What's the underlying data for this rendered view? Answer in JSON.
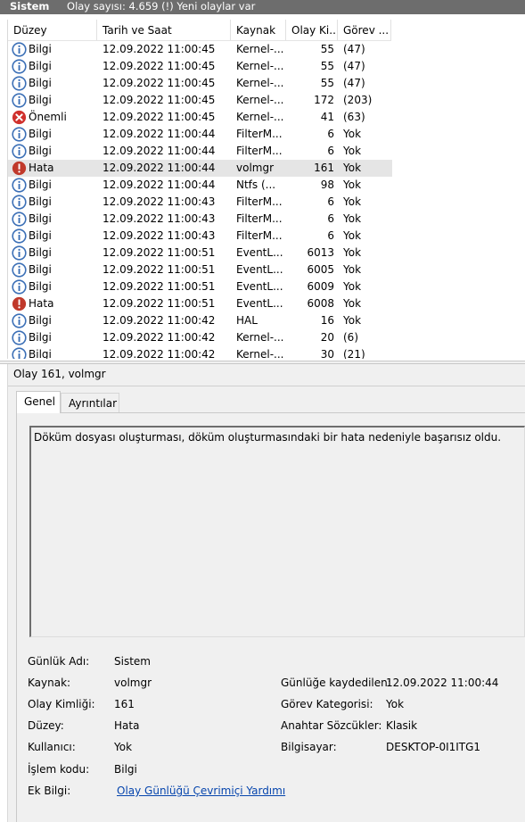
{
  "titlebar": {
    "title": "Sistem",
    "status": "Olay sayısı: 4.659 (!) Yeni olaylar var"
  },
  "columns": {
    "level": "Düzey",
    "date": "Tarih ve Saat",
    "source": "Kaynak",
    "event_id": "Olay Ki...",
    "task": "Görev ..."
  },
  "rows": [
    {
      "type": "info",
      "level": "Bilgi",
      "date": "12.09.2022 11:00:45",
      "source": "Kernel-...",
      "id": "55",
      "task": "(47)"
    },
    {
      "type": "info",
      "level": "Bilgi",
      "date": "12.09.2022 11:00:45",
      "source": "Kernel-...",
      "id": "55",
      "task": "(47)"
    },
    {
      "type": "info",
      "level": "Bilgi",
      "date": "12.09.2022 11:00:45",
      "source": "Kernel-...",
      "id": "55",
      "task": "(47)"
    },
    {
      "type": "info",
      "level": "Bilgi",
      "date": "12.09.2022 11:00:45",
      "source": "Kernel-...",
      "id": "172",
      "task": "(203)"
    },
    {
      "type": "critical",
      "level": "Önemli",
      "date": "12.09.2022 11:00:45",
      "source": "Kernel-...",
      "id": "41",
      "task": "(63)"
    },
    {
      "type": "info",
      "level": "Bilgi",
      "date": "12.09.2022 11:00:44",
      "source": "FilterM...",
      "id": "6",
      "task": "Yok"
    },
    {
      "type": "info",
      "level": "Bilgi",
      "date": "12.09.2022 11:00:44",
      "source": "FilterM...",
      "id": "6",
      "task": "Yok"
    },
    {
      "type": "error",
      "level": "Hata",
      "date": "12.09.2022 11:00:44",
      "source": "volmgr",
      "id": "161",
      "task": "Yok",
      "selected": true
    },
    {
      "type": "info",
      "level": "Bilgi",
      "date": "12.09.2022 11:00:44",
      "source": "Ntfs (...",
      "id": "98",
      "task": "Yok"
    },
    {
      "type": "info",
      "level": "Bilgi",
      "date": "12.09.2022 11:00:43",
      "source": "FilterM...",
      "id": "6",
      "task": "Yok"
    },
    {
      "type": "info",
      "level": "Bilgi",
      "date": "12.09.2022 11:00:43",
      "source": "FilterM...",
      "id": "6",
      "task": "Yok"
    },
    {
      "type": "info",
      "level": "Bilgi",
      "date": "12.09.2022 11:00:43",
      "source": "FilterM...",
      "id": "6",
      "task": "Yok"
    },
    {
      "type": "info",
      "level": "Bilgi",
      "date": "12.09.2022 11:00:51",
      "source": "EventL...",
      "id": "6013",
      "task": "Yok"
    },
    {
      "type": "info",
      "level": "Bilgi",
      "date": "12.09.2022 11:00:51",
      "source": "EventL...",
      "id": "6005",
      "task": "Yok"
    },
    {
      "type": "info",
      "level": "Bilgi",
      "date": "12.09.2022 11:00:51",
      "source": "EventL...",
      "id": "6009",
      "task": "Yok"
    },
    {
      "type": "error",
      "level": "Hata",
      "date": "12.09.2022 11:00:51",
      "source": "EventL...",
      "id": "6008",
      "task": "Yok"
    },
    {
      "type": "info",
      "level": "Bilgi",
      "date": "12.09.2022 11:00:42",
      "source": "HAL",
      "id": "16",
      "task": "Yok"
    },
    {
      "type": "info",
      "level": "Bilgi",
      "date": "12.09.2022 11:00:42",
      "source": "Kernel-...",
      "id": "20",
      "task": "(6)"
    },
    {
      "type": "info",
      "level": "Bilgi",
      "date": "12.09.2022 11:00:42",
      "source": "Kernel-...",
      "id": "30",
      "task": "(21)"
    }
  ],
  "detail": {
    "title": "Olay 161, volmgr",
    "tab_general": "Genel",
    "tab_details": "Ayrıntılar",
    "description": "Döküm dosyası oluşturması, döküm oluşturmasındaki bir hata nedeniyle başarısız oldu.",
    "fields": {
      "log_name_label": "Günlük Adı:",
      "log_name": "Sistem",
      "source_label": "Kaynak:",
      "source": "volmgr",
      "logged_label": "Günlüğe kaydedilen:",
      "logged": "12.09.2022 11:00:44",
      "event_id_label": "Olay Kimliği:",
      "event_id": "161",
      "task_category_label": "Görev Kategorisi:",
      "task_category": "Yok",
      "level_label": "Düzey:",
      "level": "Hata",
      "keywords_label": "Anahtar Sözcükler:",
      "keywords": "Klasik",
      "user_label": "Kullanıcı:",
      "user": "Yok",
      "computer_label": "Bilgisayar:",
      "computer": "DESKTOP-0I1ITG1",
      "opcode_label": "İşlem kodu:",
      "opcode": "Bilgi",
      "more_info_label": "Ek Bilgi:",
      "more_info_link": "Olay Günlüğü Çevrimiçi Yardımı"
    }
  },
  "colors": {
    "info": "#3b6fb6",
    "error": "#c0392b",
    "critical": "#d0312d",
    "selected_row": "#e5e5e5",
    "link": "#0645ad"
  }
}
